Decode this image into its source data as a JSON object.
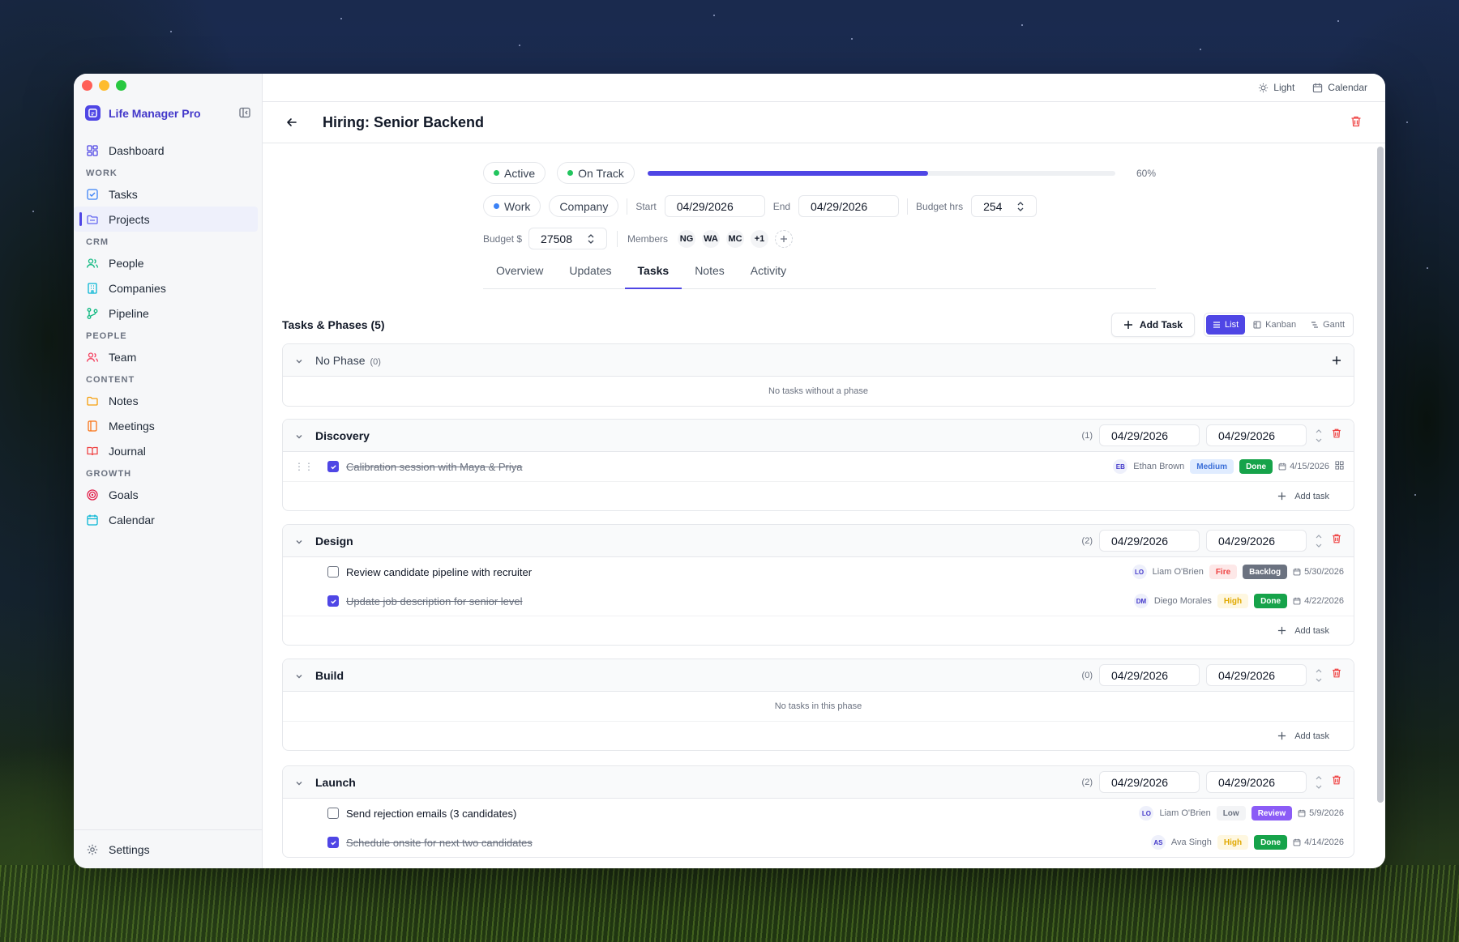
{
  "app": {
    "name": "Life Manager Pro"
  },
  "sidebar": {
    "dashboard": "Dashboard",
    "sections": {
      "work": "WORK",
      "crm": "CRM",
      "people": "PEOPLE",
      "content": "CONTENT",
      "growth": "GROWTH"
    },
    "items": {
      "tasks": "Tasks",
      "projects": "Projects",
      "people": "People",
      "companies": "Companies",
      "pipeline": "Pipeline",
      "team": "Team",
      "notes": "Notes",
      "meetings": "Meetings",
      "journal": "Journal",
      "goals": "Goals",
      "calendar": "Calendar"
    },
    "settings": "Settings",
    "active": "projects"
  },
  "topbar": {
    "theme": "Light",
    "calendar": "Calendar"
  },
  "project": {
    "title": "Hiring: Senior Backend",
    "status": "Active",
    "health": "On Track",
    "progress": 0.6,
    "progress_label": "60%",
    "area": "Work",
    "company": "Company",
    "start_label": "Start",
    "start": "04/29/2026",
    "end_label": "End",
    "end": "04/29/2026",
    "budget_hrs_label": "Budget hrs",
    "budget_hrs": "254",
    "budget_label": "Budget $",
    "budget": "27508",
    "members_label": "Members",
    "members": [
      "NG",
      "WA",
      "MC",
      "+1"
    ]
  },
  "tabs": [
    "Overview",
    "Updates",
    "Tasks",
    "Notes",
    "Activity"
  ],
  "active_tab": "Tasks",
  "tasks_section": {
    "title": "Tasks & Phases (5)",
    "add_task": "Add Task",
    "views": [
      "List",
      "Kanban",
      "Gantt"
    ],
    "active_view": "List"
  },
  "no_phase": {
    "name": "No Phase",
    "count": "(0)",
    "empty": "No tasks without a phase"
  },
  "phases": [
    {
      "name": "Discovery",
      "count": "(1)",
      "start": "04/29/2026",
      "end": "04/29/2026",
      "tasks": [
        {
          "name": "Calibration session with Maya & Priya",
          "done": true,
          "initials": "EB",
          "assignee": "Ethan Brown",
          "priority": "Medium",
          "status": "Done",
          "due": "4/15/2026"
        }
      ],
      "add_label": "Add task"
    },
    {
      "name": "Design",
      "count": "(2)",
      "start": "04/29/2026",
      "end": "04/29/2026",
      "tasks": [
        {
          "name": "Review candidate pipeline with recruiter",
          "done": false,
          "initials": "LO",
          "assignee": "Liam O'Brien",
          "priority": "Fire",
          "status": "Backlog",
          "due": "5/30/2026"
        },
        {
          "name": "Update job description for senior level",
          "done": true,
          "initials": "DM",
          "assignee": "Diego Morales",
          "priority": "High",
          "status": "Done",
          "due": "4/22/2026"
        }
      ],
      "add_label": "Add task"
    },
    {
      "name": "Build",
      "count": "(0)",
      "start": "04/29/2026",
      "end": "04/29/2026",
      "empty": "No tasks in this phase",
      "add_label": "Add task"
    },
    {
      "name": "Launch",
      "count": "(2)",
      "start": "04/29/2026",
      "end": "04/29/2026",
      "tasks": [
        {
          "name": "Send rejection emails (3 candidates)",
          "done": false,
          "initials": "LO",
          "assignee": "Liam O'Brien",
          "priority": "Low",
          "status": "Review",
          "due": "5/9/2026"
        },
        {
          "name": "Schedule onsite for next two candidates",
          "done": true,
          "initials": "AS",
          "assignee": "Ava Singh",
          "priority": "High",
          "status": "Done",
          "due": "4/14/2026"
        }
      ]
    }
  ],
  "colors": {
    "accent": "#4f46e5",
    "active_dot": "#22c55e",
    "work_dot": "#3b82f6",
    "danger": "#ef4444"
  }
}
